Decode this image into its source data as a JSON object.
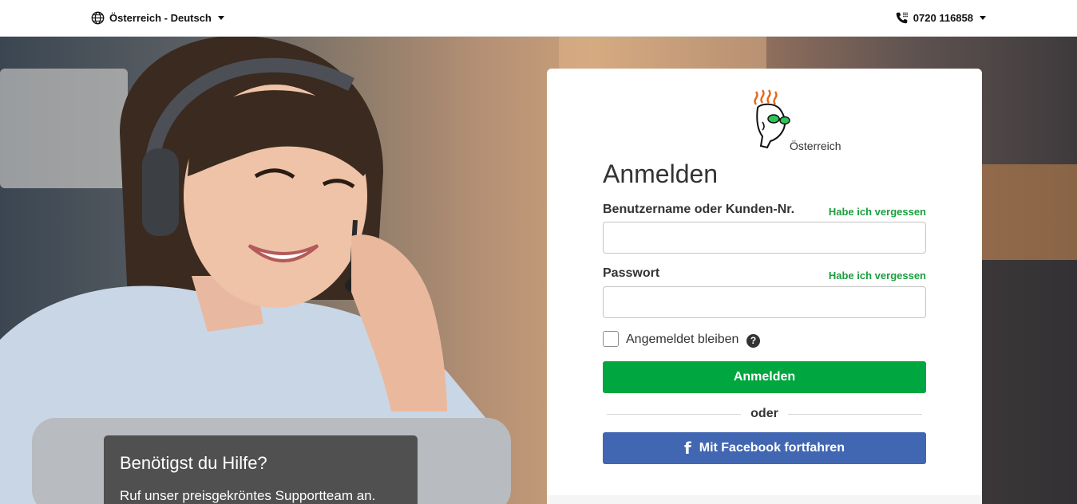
{
  "topbar": {
    "locale_icon": "globe-icon",
    "locale_label": "Österreich - Deutsch",
    "phone_icon": "phone-icon",
    "phone_number": "0720 116858"
  },
  "help": {
    "title": "Benötigst du Hilfe?",
    "text": "Ruf unser preisgekröntes Supportteam an."
  },
  "login": {
    "logo_label": "Österreich",
    "title": "Anmelden",
    "username_label": "Benutzername oder Kunden-Nr.",
    "username_value": "",
    "forgot_username": "Habe ich vergessen",
    "password_label": "Passwort",
    "password_value": "",
    "forgot_password": "Habe ich vergessen",
    "remember_label": "Angemeldet bleiben",
    "help_icon": "question-icon",
    "submit_label": "Anmelden",
    "or_label": "oder",
    "facebook_icon": "facebook-icon",
    "facebook_label": "Mit Facebook fortfahren"
  },
  "colors": {
    "primary_green": "#00a63f",
    "link_green": "#1b9e3e",
    "facebook_blue": "#4267b2",
    "help_box": "#4a4a4a"
  }
}
